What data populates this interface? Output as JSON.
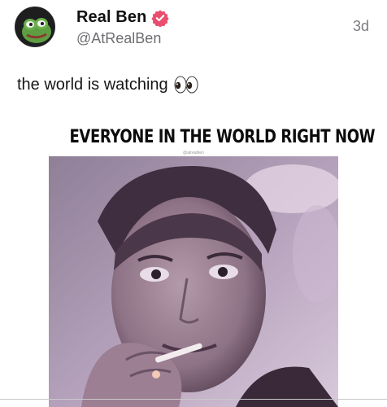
{
  "post": {
    "author": {
      "display_name": "Real Ben",
      "handle": "@AtRealBen",
      "verified": true,
      "avatar_icon": "frog-avatar-icon",
      "verified_icon": "verified-badge-icon",
      "verified_color": "#e94d6f"
    },
    "timestamp": "3d",
    "text": "the world is watching",
    "emoji_icon": "eyes-emoji-icon",
    "media": {
      "caption": "EVERYONE IN THE WORLD RIGHT NOW",
      "watermark": "@atrealben",
      "tint_color": "#b9a4bf"
    }
  }
}
